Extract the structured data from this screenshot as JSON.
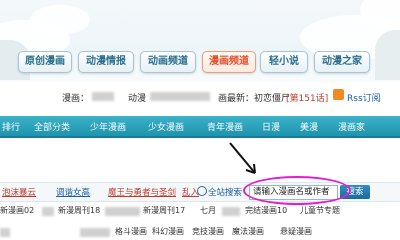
{
  "nav": {
    "buttons": [
      "原创漫画",
      "动漫情报",
      "动画频道",
      "漫画频道",
      "轻小说",
      "动漫之家"
    ],
    "active_index": 3
  },
  "info_bar": {
    "prefix": "漫画：",
    "middle": "动漫",
    "latest": "画最新：初恋僵尸",
    "episode": "[第151话]",
    "rss": "Rss订阅"
  },
  "categories": [
    "排行",
    "全部分类",
    "少年漫画",
    "少女漫画",
    "青年漫画",
    "日漫",
    "美漫",
    "漫画家"
  ],
  "search_row": {
    "links": [
      "泡沫暴云",
      "调谐女高",
      "魔王与勇者与圣剑",
      "乱入"
    ],
    "site_search_label": "全站搜索",
    "input_placeholder": "请输入漫画名或作者",
    "button_label": "搜索"
  },
  "list_row1": [
    "新漫画02",
    "新漫周刊18",
    "新漫周刊17",
    "七月",
    "完结漫画10",
    "儿童节专题"
  ],
  "list_row2": [
    "格斗漫画",
    "科幻漫画",
    "竞技漫画",
    "魔法漫画",
    "悬疑漫画"
  ],
  "colors": {
    "accent": "#1f93ad",
    "active": "#e0502a",
    "link_red": "#c0392b",
    "link_blue": "#1a5fa8",
    "annotation": "#e11fd0"
  }
}
